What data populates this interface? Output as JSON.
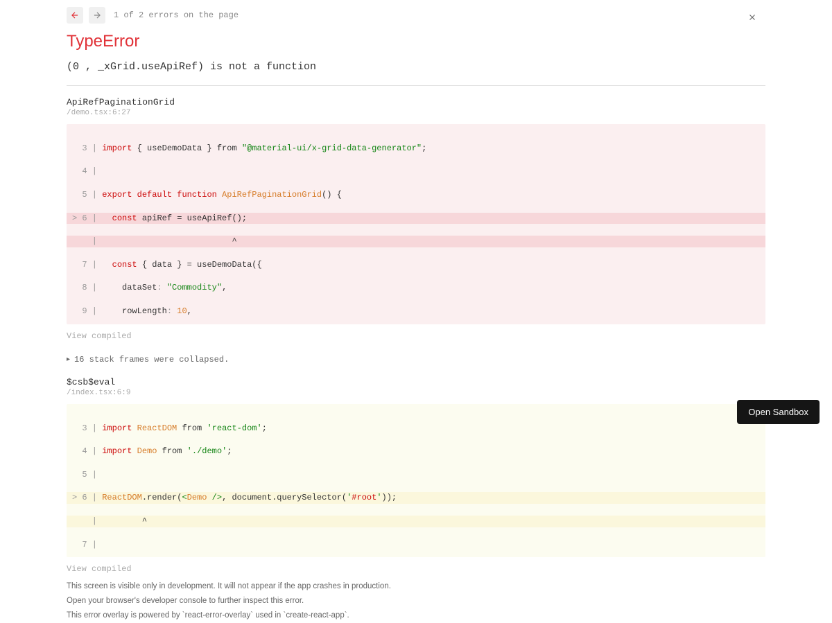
{
  "nav": {
    "error_count_text": "1 of 2 errors on the page"
  },
  "error": {
    "type": "TypeError",
    "message": "(0 , _xGrid.useApiRef) is not a function"
  },
  "frames": [
    {
      "title": "ApiRefPaginationGrid",
      "location": "/demo.tsx:6:27",
      "view_compiled": "View compiled"
    },
    {
      "title": "$csb$eval",
      "location": "/index.tsx:6:9",
      "view_compiled": "View compiled"
    }
  ],
  "collapsed": {
    "text": "16 stack frames were collapsed."
  },
  "footer": {
    "line1": "This screen is visible only in development. It will not appear if the app crashes in production.",
    "line2": "Open your browser's developer console to further inspect this error.",
    "line3": "This error overlay is powered by `react-error-overlay` used in `create-react-app`."
  },
  "sandbox_button": "Open Sandbox",
  "code1": {
    "l3_import": "import",
    "l3_mid": " { useDemoData } from ",
    "l3_str": "\"@material-ui/x-grid-data-generator\"",
    "l5_export": "export default function",
    "l5_name": " ApiRefPaginationGrid",
    "l5_tail": "() {",
    "l6_const": "const",
    "l6_rest": " apiRef = useApiRef();",
    "l7_const": "const",
    "l7_rest": " { data } = useDemoData({",
    "l8_key": "    dataSet",
    "l8_colon": ": ",
    "l8_val": "\"Commodity\"",
    "l9_key": "    rowLength",
    "l9_colon": ": ",
    "l9_val": "10"
  },
  "code2": {
    "l3_import": "import",
    "l3_name": " ReactDOM",
    "l3_from": " from ",
    "l3_str": "'react-dom'",
    "l4_import": "import",
    "l4_name": " Demo",
    "l4_from": " from ",
    "l4_str": "'./demo'",
    "l6_rd": "ReactDOM",
    "l6_render": ".render(",
    "l6_jsx_open": "<",
    "l6_jsx_name": "Demo",
    "l6_jsx_close": " />",
    "l6_after": ", document.querySelector(",
    "l6_q1": "'",
    "l6_sel": "#root",
    "l6_q2": "'",
    "l6_tail": "));"
  }
}
